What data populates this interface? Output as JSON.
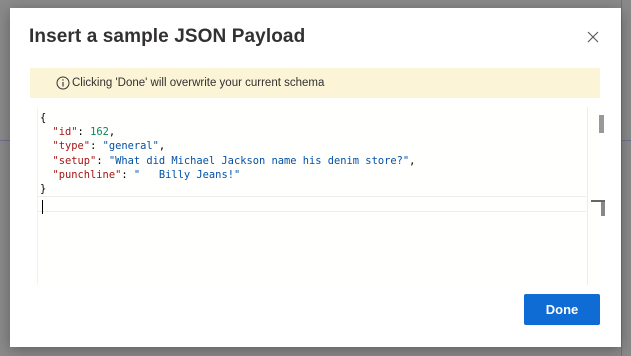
{
  "dialog": {
    "title": "Insert a sample JSON Payload",
    "close_icon": "close-icon"
  },
  "warning": {
    "icon": "info-icon",
    "text": "Clicking 'Done' will overwrite your current schema"
  },
  "editor": {
    "lines": [
      {
        "parts": [
          {
            "t": "{",
            "c": "brace"
          }
        ]
      },
      {
        "parts": [
          {
            "t": "  ",
            "c": ""
          },
          {
            "t": "\"id\"",
            "c": "key"
          },
          {
            "t": ": ",
            "c": ""
          },
          {
            "t": "162",
            "c": "num"
          },
          {
            "t": ",",
            "c": ""
          }
        ]
      },
      {
        "parts": [
          {
            "t": "  ",
            "c": ""
          },
          {
            "t": "\"type\"",
            "c": "key"
          },
          {
            "t": ": ",
            "c": ""
          },
          {
            "t": "\"general\"",
            "c": "str"
          },
          {
            "t": ",",
            "c": ""
          }
        ]
      },
      {
        "parts": [
          {
            "t": "  ",
            "c": ""
          },
          {
            "t": "\"setup\"",
            "c": "key"
          },
          {
            "t": ": ",
            "c": ""
          },
          {
            "t": "\"What did Michael Jackson name his denim store?\"",
            "c": "str"
          },
          {
            "t": ",",
            "c": ""
          }
        ]
      },
      {
        "parts": [
          {
            "t": "  ",
            "c": ""
          },
          {
            "t": "\"punchline\"",
            "c": "key"
          },
          {
            "t": ": ",
            "c": ""
          },
          {
            "t": "\"   Billy Jeans!\"",
            "c": "str"
          }
        ]
      },
      {
        "parts": [
          {
            "t": "}",
            "c": "brace"
          }
        ]
      }
    ]
  },
  "actions": {
    "done_label": "Done"
  },
  "colors": {
    "primary": "#0f6cd4",
    "warning_bg": "#fcf4d6",
    "json_key": "#a31515",
    "json_string": "#0451a5",
    "json_number": "#098658"
  }
}
